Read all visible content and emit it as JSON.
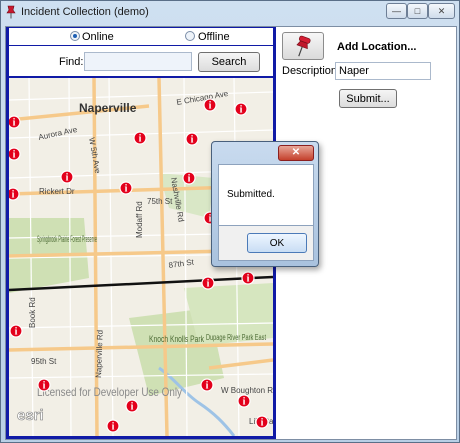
{
  "window": {
    "title": "Incident Collection (demo)",
    "controls": {
      "minimize": "—",
      "maximize": "□",
      "close": "✕"
    }
  },
  "mode": {
    "options": [
      {
        "label": "Online",
        "selected": true
      },
      {
        "label": "Offline",
        "selected": false
      }
    ]
  },
  "find": {
    "label": "Find:",
    "value": "",
    "button": "Search"
  },
  "map": {
    "city_label": "Naperville",
    "streets": [
      "E Chicago Ave",
      "Aurora Ave",
      "W 5th Ave",
      "Rickert Dr",
      "75th St",
      "Nashville Rd",
      "Modaff Rd",
      "87th St",
      "95th St",
      "Book Rd",
      "Naperville Rd",
      "W Boughton Rd",
      "Lily Ca"
    ],
    "parks": [
      "Springbrook Prairie Forest Preserve",
      "Knoch Knolls Park",
      "Dupage River Park East"
    ],
    "watermark": "Licensed for Developer Use Only",
    "logo": "esri",
    "incident_icon": "i",
    "incident_count": 20,
    "colors": {
      "incident": "#e3001b",
      "boundary": "#111111",
      "road": "#f6c98a",
      "park": "#cfe0b4"
    }
  },
  "panel": {
    "heading": "Add Location...",
    "description_label": "Description:",
    "description_value": "Naper",
    "submit_label": "Submit...",
    "pin_icon": "pushpin-icon"
  },
  "dialog": {
    "close": "✕",
    "message": "Submitted.",
    "ok_label": "OK"
  }
}
